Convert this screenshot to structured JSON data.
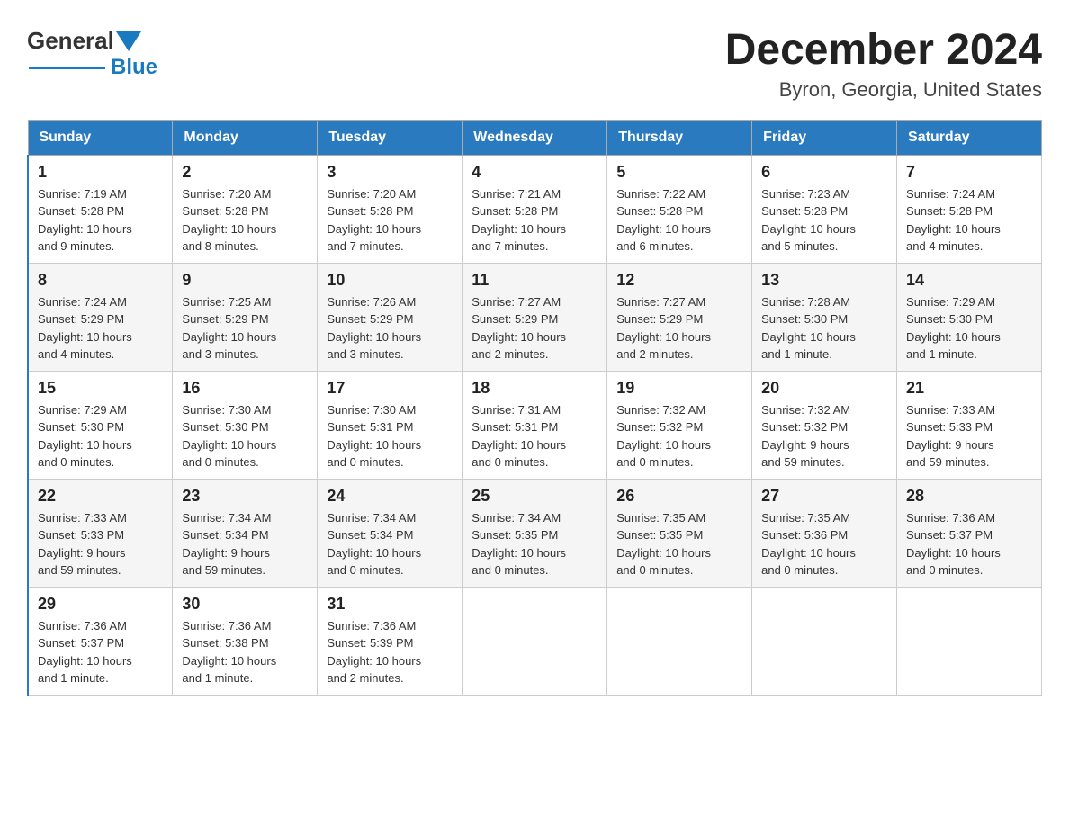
{
  "header": {
    "logo_general": "General",
    "logo_blue": "Blue",
    "title": "December 2024",
    "subtitle": "Byron, Georgia, United States"
  },
  "calendar": {
    "days_of_week": [
      "Sunday",
      "Monday",
      "Tuesday",
      "Wednesday",
      "Thursday",
      "Friday",
      "Saturday"
    ],
    "weeks": [
      [
        {
          "day": "1",
          "info": "Sunrise: 7:19 AM\nSunset: 5:28 PM\nDaylight: 10 hours\nand 9 minutes."
        },
        {
          "day": "2",
          "info": "Sunrise: 7:20 AM\nSunset: 5:28 PM\nDaylight: 10 hours\nand 8 minutes."
        },
        {
          "day": "3",
          "info": "Sunrise: 7:20 AM\nSunset: 5:28 PM\nDaylight: 10 hours\nand 7 minutes."
        },
        {
          "day": "4",
          "info": "Sunrise: 7:21 AM\nSunset: 5:28 PM\nDaylight: 10 hours\nand 7 minutes."
        },
        {
          "day": "5",
          "info": "Sunrise: 7:22 AM\nSunset: 5:28 PM\nDaylight: 10 hours\nand 6 minutes."
        },
        {
          "day": "6",
          "info": "Sunrise: 7:23 AM\nSunset: 5:28 PM\nDaylight: 10 hours\nand 5 minutes."
        },
        {
          "day": "7",
          "info": "Sunrise: 7:24 AM\nSunset: 5:28 PM\nDaylight: 10 hours\nand 4 minutes."
        }
      ],
      [
        {
          "day": "8",
          "info": "Sunrise: 7:24 AM\nSunset: 5:29 PM\nDaylight: 10 hours\nand 4 minutes."
        },
        {
          "day": "9",
          "info": "Sunrise: 7:25 AM\nSunset: 5:29 PM\nDaylight: 10 hours\nand 3 minutes."
        },
        {
          "day": "10",
          "info": "Sunrise: 7:26 AM\nSunset: 5:29 PM\nDaylight: 10 hours\nand 3 minutes."
        },
        {
          "day": "11",
          "info": "Sunrise: 7:27 AM\nSunset: 5:29 PM\nDaylight: 10 hours\nand 2 minutes."
        },
        {
          "day": "12",
          "info": "Sunrise: 7:27 AM\nSunset: 5:29 PM\nDaylight: 10 hours\nand 2 minutes."
        },
        {
          "day": "13",
          "info": "Sunrise: 7:28 AM\nSunset: 5:30 PM\nDaylight: 10 hours\nand 1 minute."
        },
        {
          "day": "14",
          "info": "Sunrise: 7:29 AM\nSunset: 5:30 PM\nDaylight: 10 hours\nand 1 minute."
        }
      ],
      [
        {
          "day": "15",
          "info": "Sunrise: 7:29 AM\nSunset: 5:30 PM\nDaylight: 10 hours\nand 0 minutes."
        },
        {
          "day": "16",
          "info": "Sunrise: 7:30 AM\nSunset: 5:30 PM\nDaylight: 10 hours\nand 0 minutes."
        },
        {
          "day": "17",
          "info": "Sunrise: 7:30 AM\nSunset: 5:31 PM\nDaylight: 10 hours\nand 0 minutes."
        },
        {
          "day": "18",
          "info": "Sunrise: 7:31 AM\nSunset: 5:31 PM\nDaylight: 10 hours\nand 0 minutes."
        },
        {
          "day": "19",
          "info": "Sunrise: 7:32 AM\nSunset: 5:32 PM\nDaylight: 10 hours\nand 0 minutes."
        },
        {
          "day": "20",
          "info": "Sunrise: 7:32 AM\nSunset: 5:32 PM\nDaylight: 9 hours\nand 59 minutes."
        },
        {
          "day": "21",
          "info": "Sunrise: 7:33 AM\nSunset: 5:33 PM\nDaylight: 9 hours\nand 59 minutes."
        }
      ],
      [
        {
          "day": "22",
          "info": "Sunrise: 7:33 AM\nSunset: 5:33 PM\nDaylight: 9 hours\nand 59 minutes."
        },
        {
          "day": "23",
          "info": "Sunrise: 7:34 AM\nSunset: 5:34 PM\nDaylight: 9 hours\nand 59 minutes."
        },
        {
          "day": "24",
          "info": "Sunrise: 7:34 AM\nSunset: 5:34 PM\nDaylight: 10 hours\nand 0 minutes."
        },
        {
          "day": "25",
          "info": "Sunrise: 7:34 AM\nSunset: 5:35 PM\nDaylight: 10 hours\nand 0 minutes."
        },
        {
          "day": "26",
          "info": "Sunrise: 7:35 AM\nSunset: 5:35 PM\nDaylight: 10 hours\nand 0 minutes."
        },
        {
          "day": "27",
          "info": "Sunrise: 7:35 AM\nSunset: 5:36 PM\nDaylight: 10 hours\nand 0 minutes."
        },
        {
          "day": "28",
          "info": "Sunrise: 7:36 AM\nSunset: 5:37 PM\nDaylight: 10 hours\nand 0 minutes."
        }
      ],
      [
        {
          "day": "29",
          "info": "Sunrise: 7:36 AM\nSunset: 5:37 PM\nDaylight: 10 hours\nand 1 minute."
        },
        {
          "day": "30",
          "info": "Sunrise: 7:36 AM\nSunset: 5:38 PM\nDaylight: 10 hours\nand 1 minute."
        },
        {
          "day": "31",
          "info": "Sunrise: 7:36 AM\nSunset: 5:39 PM\nDaylight: 10 hours\nand 2 minutes."
        },
        {
          "day": "",
          "info": ""
        },
        {
          "day": "",
          "info": ""
        },
        {
          "day": "",
          "info": ""
        },
        {
          "day": "",
          "info": ""
        }
      ]
    ]
  }
}
